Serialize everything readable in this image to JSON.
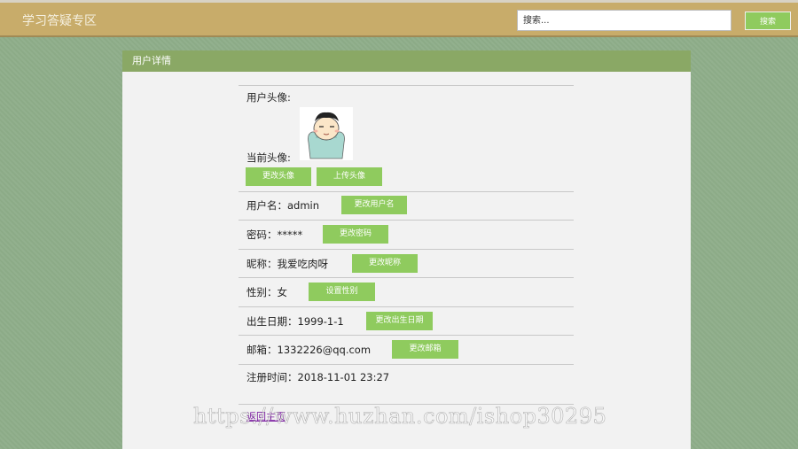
{
  "header": {
    "site_title": "学习答疑专区",
    "search_placeholder": "搜索...",
    "search_button": "搜索"
  },
  "panel": {
    "title": "用户详情"
  },
  "avatar": {
    "label": "用户头像:",
    "current_label": "当前头像:",
    "change_button": "更改头像",
    "upload_button": "上传头像"
  },
  "fields": {
    "username": {
      "label": "用户名：admin",
      "button": "更改用户名"
    },
    "password": {
      "label": "密码：*****",
      "button": "更改密码"
    },
    "nickname": {
      "label": "昵称：我爱吃肉呀",
      "button": "更改昵称"
    },
    "gender": {
      "label": "性别：女",
      "button": "设置性别"
    },
    "birthday": {
      "label": "出生日期：1999-1-1",
      "button": "更改出生日期"
    },
    "email": {
      "label": "邮箱：1332226@qq.com",
      "button": "更改邮箱"
    },
    "register_time": {
      "label": "注册时间：2018-11-01 23:27"
    }
  },
  "back_link": "返回主页",
  "watermark": "https://www.huzhan.com/ishop30295",
  "colors": {
    "accent_button": "#8fcb5e",
    "header_bar": "#c8ac6a",
    "panel_header": "#8aa865",
    "background": "#8fae8a"
  }
}
